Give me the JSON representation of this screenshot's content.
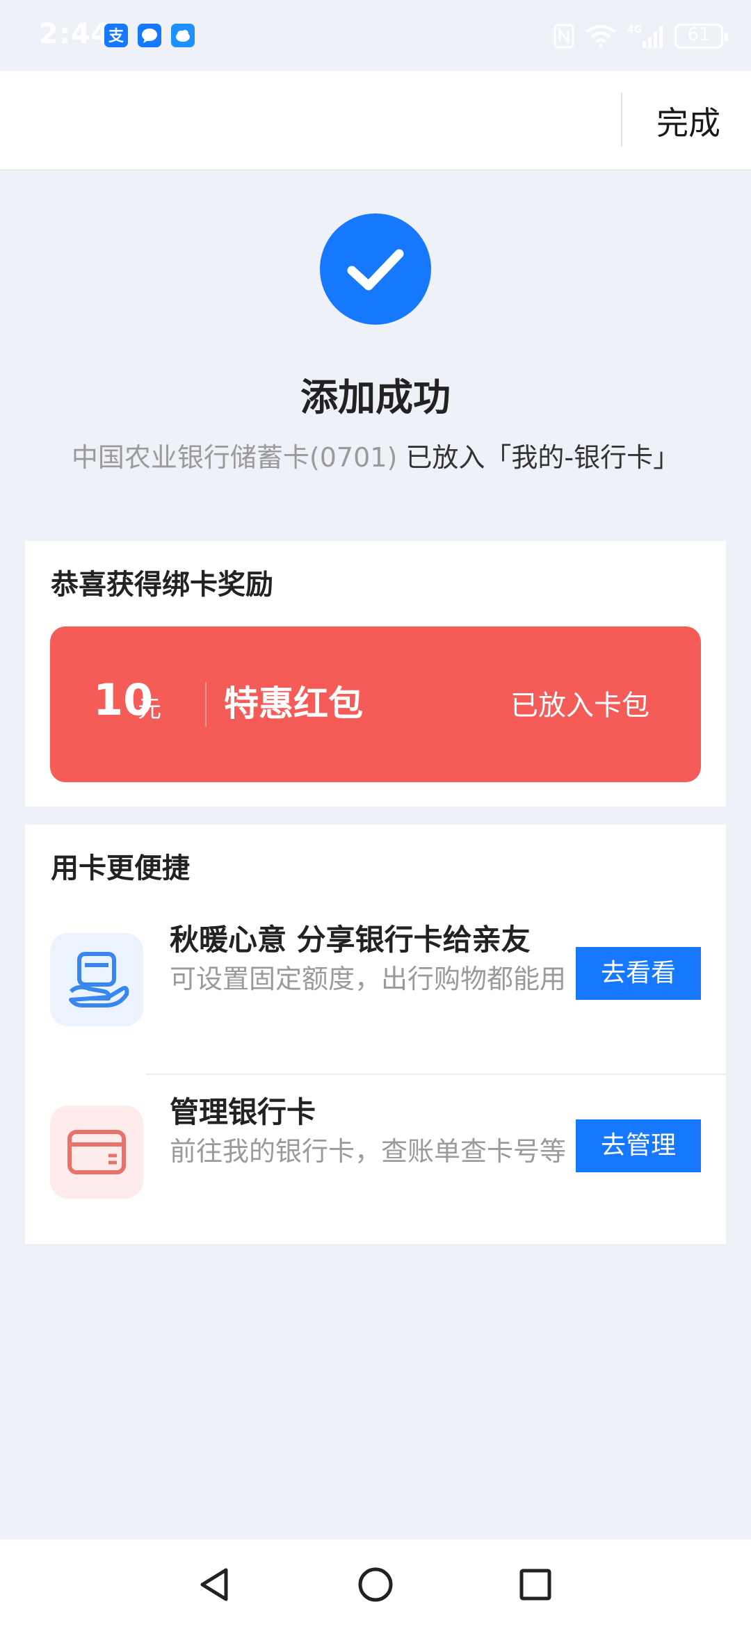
{
  "status_bar": {
    "time": "2:44",
    "battery": "61",
    "icons": [
      "alipay-notification-icon",
      "message-notification-icon",
      "cloud-notification-icon",
      "nfc-icon",
      "wifi-icon",
      "signal-4g-icon",
      "battery-icon"
    ]
  },
  "header": {
    "done_label": "完成"
  },
  "success": {
    "title": "添加成功",
    "card_name": "中国农业银行储蓄卡(0701)",
    "destination": " 已放入「我的-银行卡」"
  },
  "reward": {
    "section_title": "恭喜获得绑卡奖励",
    "amount": "10",
    "unit": "元",
    "name": "特惠红包",
    "status": "已放入卡包",
    "color": "#f55c57"
  },
  "convenience": {
    "section_title": "用卡更便捷",
    "items": [
      {
        "icon": "share-card-hand-icon",
        "title": "秋暖心意 分享银行卡给亲友",
        "desc": "可设置固定额度，出行购物都能用",
        "button": "去看看"
      },
      {
        "icon": "bank-card-icon",
        "title": "管理银行卡",
        "desc": "前往我的银行卡，查账单查卡号等",
        "button": "去管理"
      }
    ]
  },
  "nav": {
    "icons": [
      "back-icon",
      "home-icon",
      "recent-apps-icon"
    ]
  },
  "colors": {
    "accent": "#1677ff",
    "background": "#eef1f8",
    "coupon": "#f55c57"
  }
}
